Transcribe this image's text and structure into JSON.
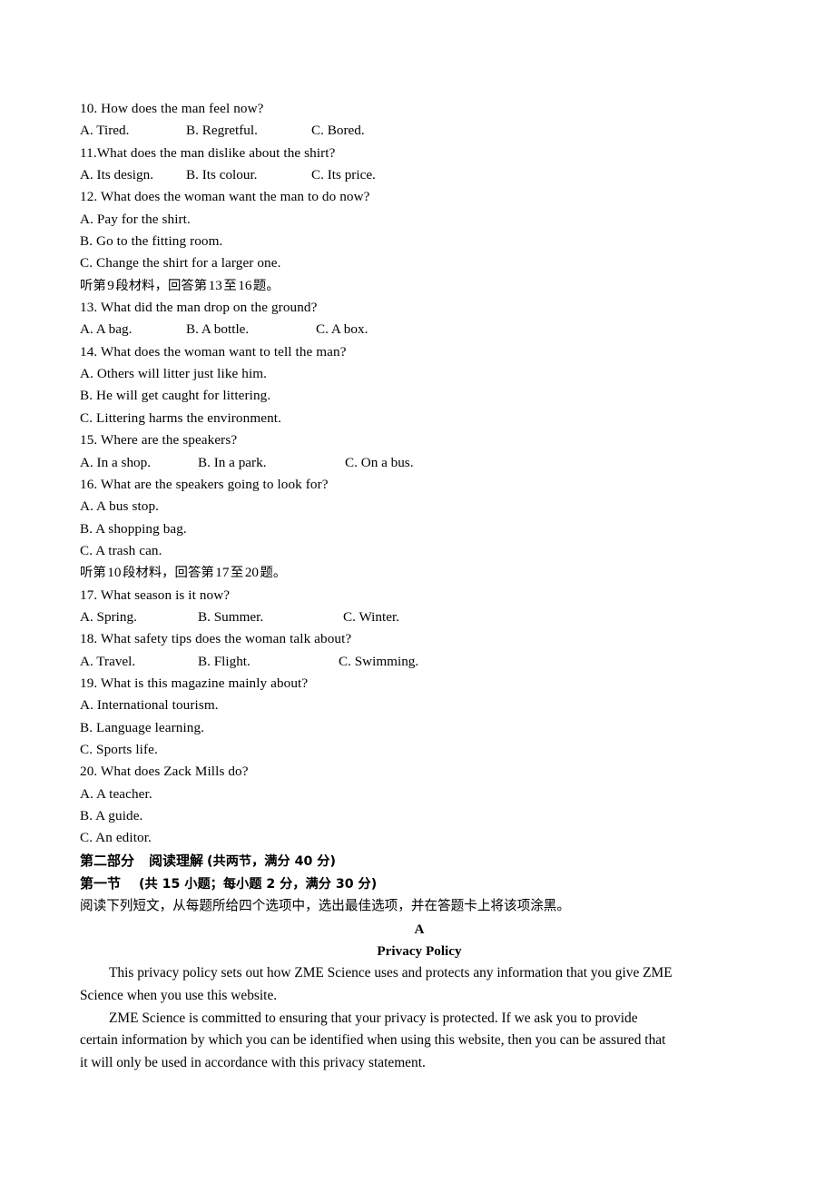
{
  "document": {
    "type": "english-exam-paper",
    "language": "en-zh"
  },
  "listening": {
    "questions": [
      {
        "number": "10.",
        "stem": "10. How does the man feel now?",
        "layout": "row",
        "columns": [
          0,
          117,
          255
        ],
        "options": [
          "A. Tired.",
          "B. Regretful.",
          "C. Bored."
        ]
      },
      {
        "number": "11.",
        "stem": "11.What does the man dislike about the shirt?",
        "layout": "row",
        "columns": [
          0,
          117,
          255
        ],
        "options": [
          "A. Its design.",
          "B. Its colour.",
          "C. Its price."
        ]
      },
      {
        "number": "12.",
        "stem": "12. What does the woman want the man to do now?",
        "layout": "stack",
        "options": [
          "A. Pay for the shirt.",
          "B. Go to the fitting room.",
          "C. Change the shirt for a larger one."
        ]
      }
    ],
    "cue_9": {
      "prefix": "听第",
      "material_no": "9",
      "middle": "段材料，回答第",
      "from_no": "13",
      "to_word": "至",
      "to_no": "16",
      "suffix": "题。"
    },
    "questions_9": [
      {
        "number": "13.",
        "stem": "13. What did the man drop on the ground?",
        "layout": "row",
        "columns": [
          0,
          117,
          260
        ],
        "options": [
          "A. A bag.",
          "B. A bottle.",
          "C. A box."
        ]
      },
      {
        "number": "14.",
        "stem": "14. What does the woman want to tell the man?",
        "layout": "stack",
        "options": [
          "A. Others will litter just like him.",
          "B. He will get caught for littering.",
          "C. Littering harms the environment."
        ]
      },
      {
        "number": "15.",
        "stem": "15. Where are the speakers?",
        "layout": "row",
        "columns": [
          0,
          130,
          292
        ],
        "options": [
          "A. In a shop.",
          "B. In a park.",
          "C. On a bus."
        ]
      },
      {
        "number": "16.",
        "stem": "16. What are the speakers going to look for?",
        "layout": "stack",
        "options": [
          "A. A bus stop.",
          "B. A shopping bag.",
          "C. A trash can."
        ]
      }
    ],
    "cue_10": {
      "prefix": "听第",
      "material_no": "10",
      "middle": "段材料，回答第",
      "from_no": "17",
      "to_word": "至",
      "to_no": "20",
      "suffix": "题。"
    },
    "questions_10": [
      {
        "number": "17.",
        "stem": "17. What season is it now?",
        "layout": "row",
        "columns": [
          0,
          130,
          290
        ],
        "options": [
          "A. Spring.",
          "B. Summer.",
          "C. Winter."
        ]
      },
      {
        "number": "18.",
        "stem": "18. What safety tips does the woman talk about?",
        "layout": "row",
        "columns": [
          0,
          130,
          285
        ],
        "options": [
          "A. Travel.",
          "B. Flight.",
          "C. Swimming."
        ]
      },
      {
        "number": "19.",
        "stem": "19. What is this magazine mainly about?",
        "layout": "stack",
        "options": [
          "A. International tourism.",
          "B. Language learning.",
          "C. Sports life."
        ]
      },
      {
        "number": "20.",
        "stem": "20. What does Zack Mills do?",
        "layout": "stack",
        "options": [
          "A. A teacher.",
          "B. A guide.",
          "C. An editor."
        ]
      }
    ]
  },
  "part_two": {
    "heading_label": "第二部分",
    "heading_title": "阅读理解",
    "heading_paren": "(共两节，满分 40 分)",
    "section_one_label": "第一节",
    "section_one_paren": "(共 15 小题；每小题 2 分，满分 30 分)",
    "directions": "阅读下列短文，从每题所给四个选项中，选出最佳选项，并在答题卡上将该项涂黑。",
    "passage_letter": "A",
    "passage_title": "Privacy Policy",
    "paragraphs": [
      "This privacy policy sets out how ZME Science uses and protects any information that you give ZME Science when you use this website.",
      "ZME Science is committed to ensuring that your privacy is protected. If we ask you to provide certain information by which you can be identified when using this website, then you can be assured that it will only be used in accordance with this privacy statement."
    ]
  }
}
